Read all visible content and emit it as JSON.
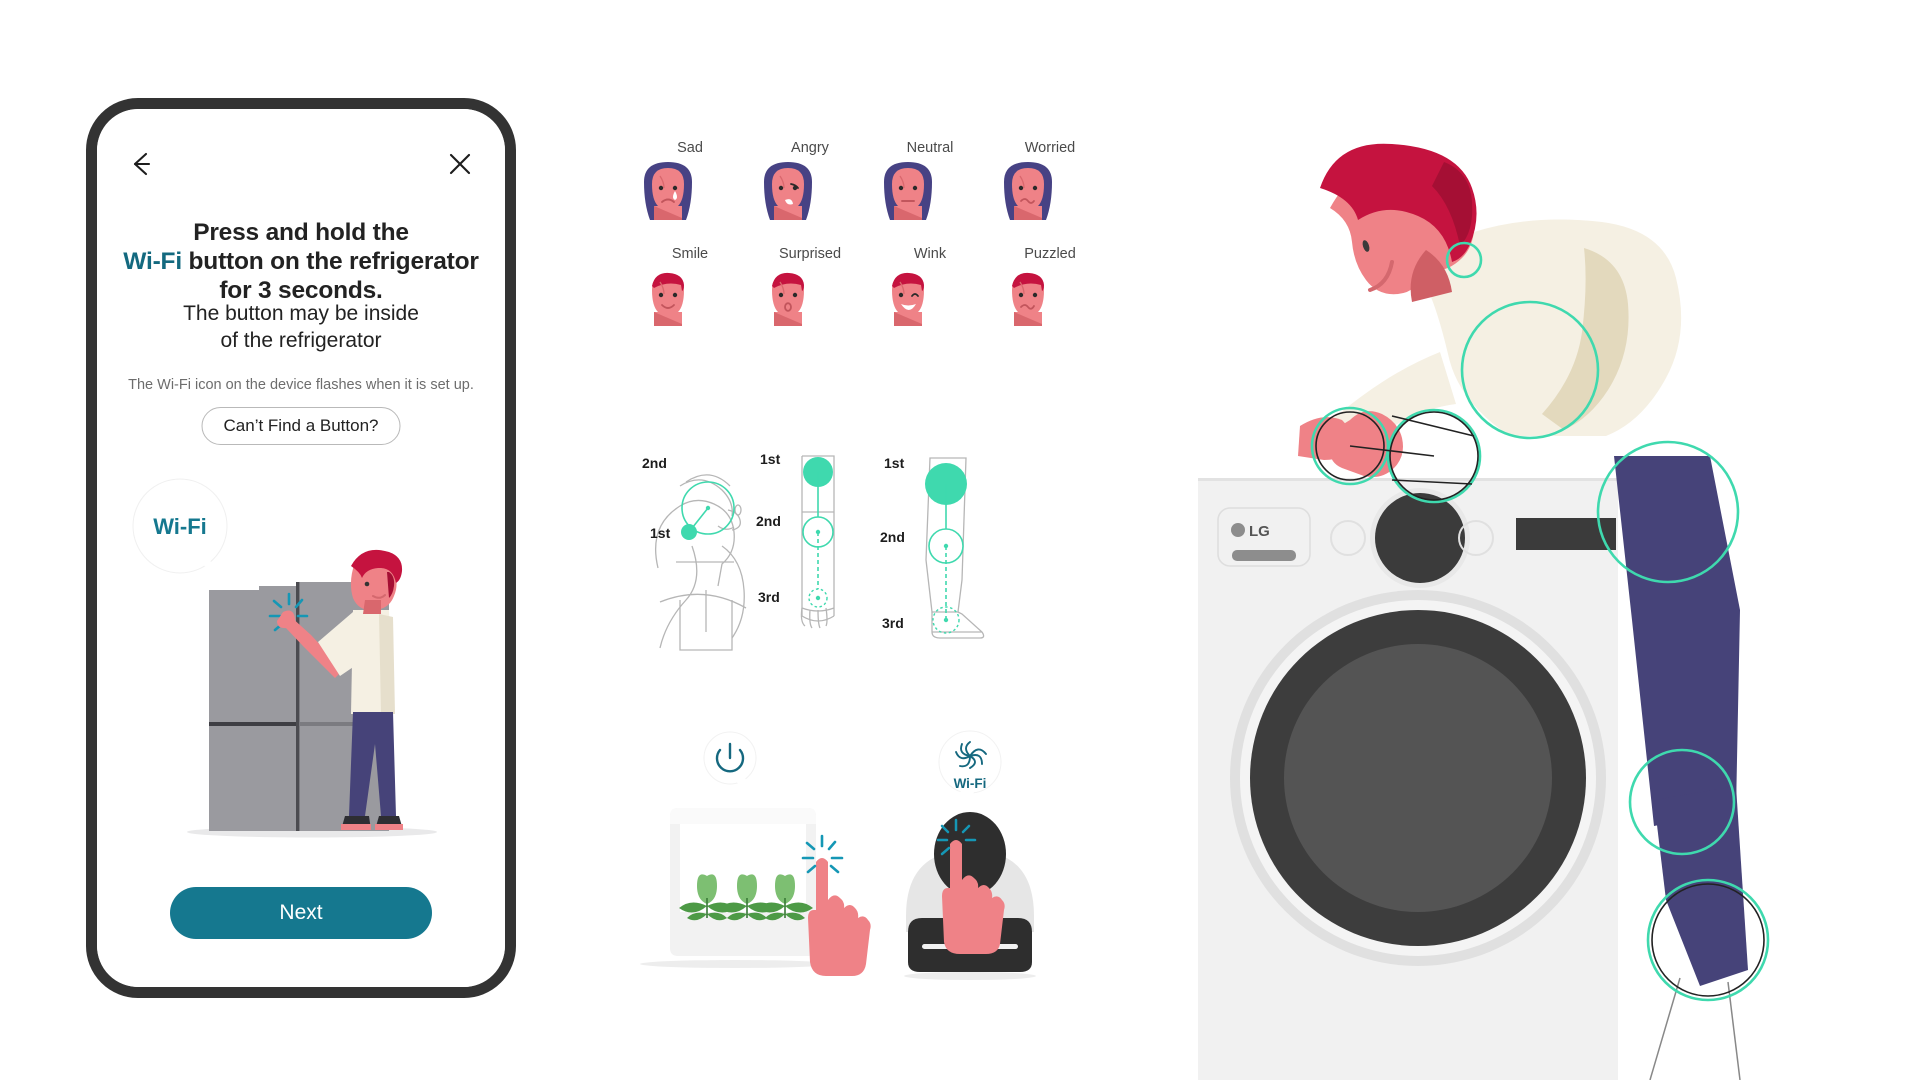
{
  "phone": {
    "back_icon": "back-arrow-icon",
    "close_icon": "close-x-icon",
    "headline_line1": "Press and hold the",
    "headline_wifi": "Wi-Fi",
    "headline_line2_rest": " button on the refrigerator",
    "headline_line3": "for 3 seconds.",
    "subline_line1": "The button may be inside",
    "subline_line2": "of the refrigerator",
    "hint": "The Wi-Fi icon on the device flashes when it is set up.",
    "find_button": "Can’t Find a Button?",
    "next_button": "Next",
    "bubble_label": "Wi-Fi"
  },
  "emotions": {
    "row1": [
      {
        "label": "Sad",
        "art": "female-sad-face"
      },
      {
        "label": "Angry",
        "art": "female-angry-face"
      },
      {
        "label": "Neutral",
        "art": "female-neutral-face"
      },
      {
        "label": "Worried",
        "art": "female-worried-face"
      }
    ],
    "row2": [
      {
        "label": "Smile",
        "art": "male-smile-face"
      },
      {
        "label": "Surprised",
        "art": "male-surprised-face"
      },
      {
        "label": "Wink",
        "art": "male-wink-face"
      },
      {
        "label": "Puzzled",
        "art": "male-puzzled-face"
      }
    ]
  },
  "body_diagrams": {
    "head_torso": {
      "name": "head-torso-diagram",
      "markers": [
        "2nd",
        "1st"
      ]
    },
    "arm": {
      "name": "arm-diagram",
      "markers": [
        "1st",
        "2nd",
        "3rd"
      ]
    },
    "leg": {
      "name": "leg-diagram",
      "markers": [
        "1st",
        "2nd",
        "3rd"
      ]
    }
  },
  "appliances": {
    "plant_grower": {
      "name": "plant-grower-illustration",
      "bubble_icon": "power-icon"
    },
    "cooktop": {
      "name": "cooktop-illustration",
      "bubble_icon": "wifi-swirl-icon",
      "bubble_label": "Wi-Fi"
    }
  },
  "right_scene": {
    "washer": {
      "name": "lg-washing-machine",
      "brand": "LG"
    },
    "person": {
      "name": "bending-person-figure",
      "joints": 7
    }
  },
  "colors": {
    "teal_accent": "#15788f",
    "mint": "#3fd9ae",
    "skin": "#ef8287",
    "hair_red": "#c5133f",
    "hair_navy": "#474284",
    "denim": "#464379",
    "cream": "#f5f0e3",
    "fridge_gray": "#9a9a9f",
    "washer_body": "#f1f1f1",
    "dark": "#3c3c3c"
  }
}
